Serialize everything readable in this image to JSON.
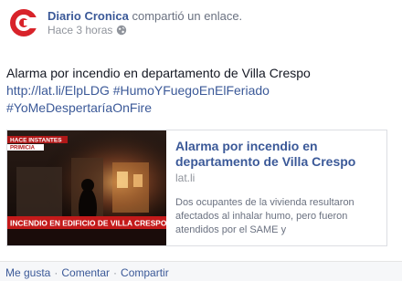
{
  "post": {
    "author": "Diario Cronica",
    "action": "compartió un enlace.",
    "time": "Hace 3 horas",
    "text_line1": "Alarma por incendio en departamento de Villa Crespo",
    "link": "http://lat.li/ElpLDG",
    "hashtag1": "#HumoYFuegoEnElFeriado",
    "hashtag2": "#YoMeDespertaríaOnFire"
  },
  "link_card": {
    "title": "Alarma por incendio en departamento de Villa Crespo",
    "domain": "lat.li",
    "description": "Dos ocupantes de la vivienda resultaron afectados al inhalar humo, pero fueron atendidos por el SAME y",
    "thumb_banner_top": "HACE INSTANTES",
    "thumb_banner_top2": "PRIMICIA",
    "thumb_banner_bottom": "INCENDIO EN EDIFICIO DE VILLA CRESPO"
  },
  "actions": {
    "like": "Me gusta",
    "comment": "Comentar",
    "share": "Compartir",
    "separator": "·"
  },
  "colors": {
    "link": "#3b5998",
    "brand_red": "#d8232a"
  }
}
